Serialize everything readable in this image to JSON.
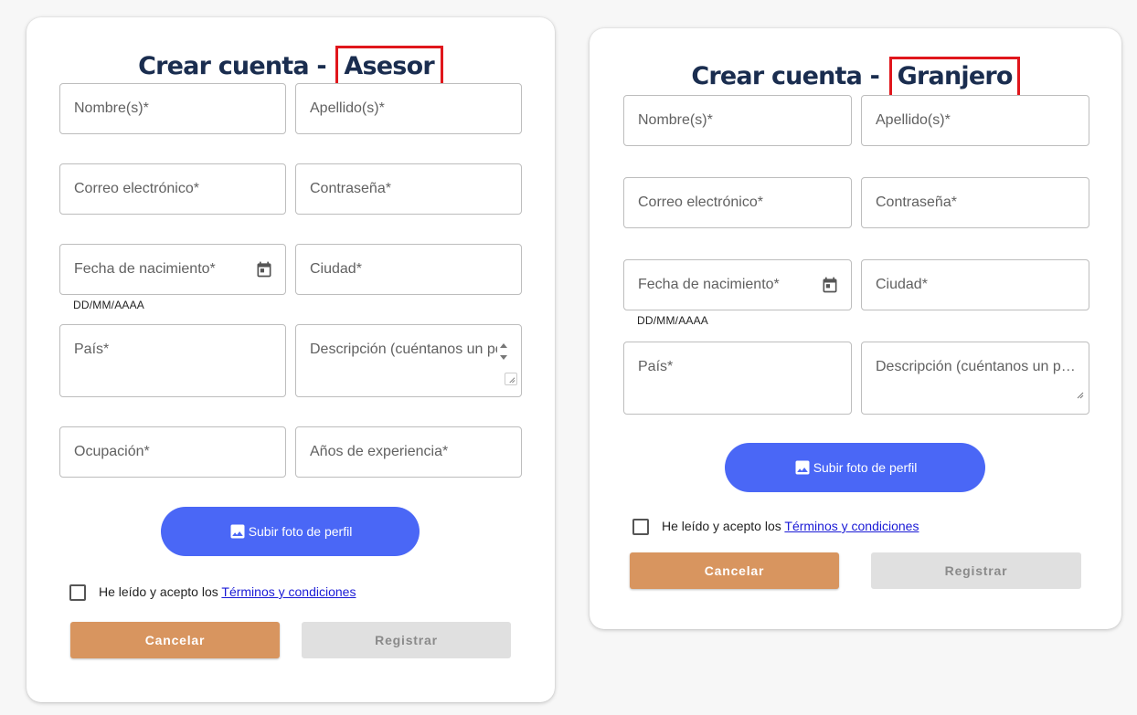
{
  "forms": [
    {
      "title_prefix": "Crear cuenta - ",
      "title_role": "Asesor",
      "fields": {
        "first_name": "Nombre(s)*",
        "last_name": "Apellido(s)*",
        "email": "Correo electrónico*",
        "password": "Contraseña*",
        "birth_date": "Fecha de nacimiento*",
        "birth_date_helper": "DD/MM/AAAA",
        "city": "Ciudad*",
        "country": "País*",
        "description": "Descripción (cuéntanos un poco de ti)",
        "occupation": "Ocupación*",
        "experience": "Años de experiencia*"
      },
      "upload_label": "Subir foto de perfil",
      "terms_text": "He leído y acepto los ",
      "terms_link": "Términos y condiciones",
      "cancel_label": "Cancelar",
      "register_label": "Registrar"
    },
    {
      "title_prefix": "Crear cuenta - ",
      "title_role": "Granjero",
      "fields": {
        "first_name": "Nombre(s)*",
        "last_name": "Apellido(s)*",
        "email": "Correo electrónico*",
        "password": "Contraseña*",
        "birth_date": "Fecha de nacimiento*",
        "birth_date_helper": "DD/MM/AAAA",
        "city": "Ciudad*",
        "country": "País*",
        "description": "Descripción (cuéntanos un poco de ti)"
      },
      "upload_label": "Subir foto de perfil",
      "terms_text": "He leído y acepto los ",
      "terms_link": "Términos y condiciones",
      "cancel_label": "Cancelar",
      "register_label": "Registrar"
    }
  ],
  "icons": {
    "calendar": "calendar-icon",
    "upload": "image-icon",
    "highlight_color": "#e0161c"
  },
  "colors": {
    "title": "#1a2d4f",
    "upload_button": "#4a67f6",
    "cancel_button": "#d8955f",
    "register_button_disabled": "#e0e0e0",
    "link": "#1a1ad6"
  }
}
